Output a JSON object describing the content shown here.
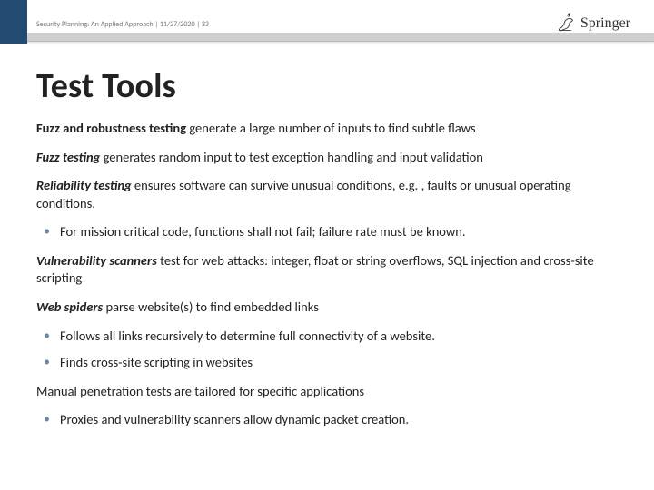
{
  "header": {
    "breadcrumb": "Security Planning: An Applied Approach | 11/27/2020 | 33",
    "brand": "Springer"
  },
  "title": "Test Tools",
  "paras": {
    "p1_lead": "Fuzz and robustness testing",
    "p1_rest": " generate a large number of inputs to find subtle flaws",
    "p2_lead": "Fuzz testing",
    "p2_rest": " generates random input to test exception handling and input validation",
    "p3_lead": "Reliability testing",
    "p3_rest": " ensures software can survive unusual conditions, e.g. , faults or unusual operating conditions.",
    "b1": "For mission critical code, functions shall not fail; failure rate must be known.",
    "p4_lead": "Vulnerability scanners",
    "p4_rest": " test for web attacks: integer, float or string overflows, SQL injection and cross-site scripting",
    "p5_lead": "Web spiders",
    "p5_rest": " parse website(s) to find embedded links",
    "b2": "Follows all links recursively to determine full connectivity of a website.",
    "b3": "Finds cross-site scripting in websites",
    "p6": "Manual penetration tests are tailored for specific applications",
    "b4": "Proxies and vulnerability scanners allow dynamic packet creation."
  }
}
